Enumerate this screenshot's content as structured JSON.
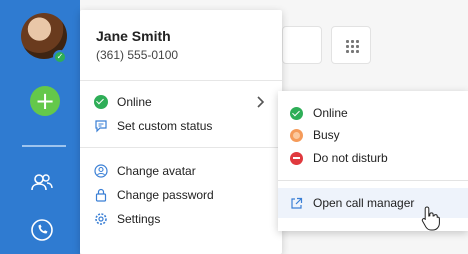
{
  "user": {
    "name": "Jane Smith",
    "phone": "(361) 555-0100"
  },
  "menu": {
    "online_label": "Online",
    "custom_status_label": "Set custom status",
    "change_avatar_label": "Change avatar",
    "change_password_label": "Change password",
    "settings_label": "Settings"
  },
  "status_submenu": {
    "online_label": "Online",
    "busy_label": "Busy",
    "dnd_label": "Do not disturb",
    "call_manager_label": "Open call manager"
  },
  "colors": {
    "rail": "#2f7bd1",
    "online": "#2eae57",
    "busy": "#f59b5a",
    "dnd": "#e0393e",
    "accent_icon": "#3a7fd5",
    "add_button": "#64c84a"
  },
  "icons": [
    "avatar",
    "add-icon",
    "contacts-icon",
    "phone-icon",
    "dialpad-icon",
    "chevron-right-icon",
    "chat-bubble-icon",
    "user-circle-icon",
    "lock-icon",
    "gear-icon",
    "external-link-icon",
    "hand-cursor-icon"
  ]
}
